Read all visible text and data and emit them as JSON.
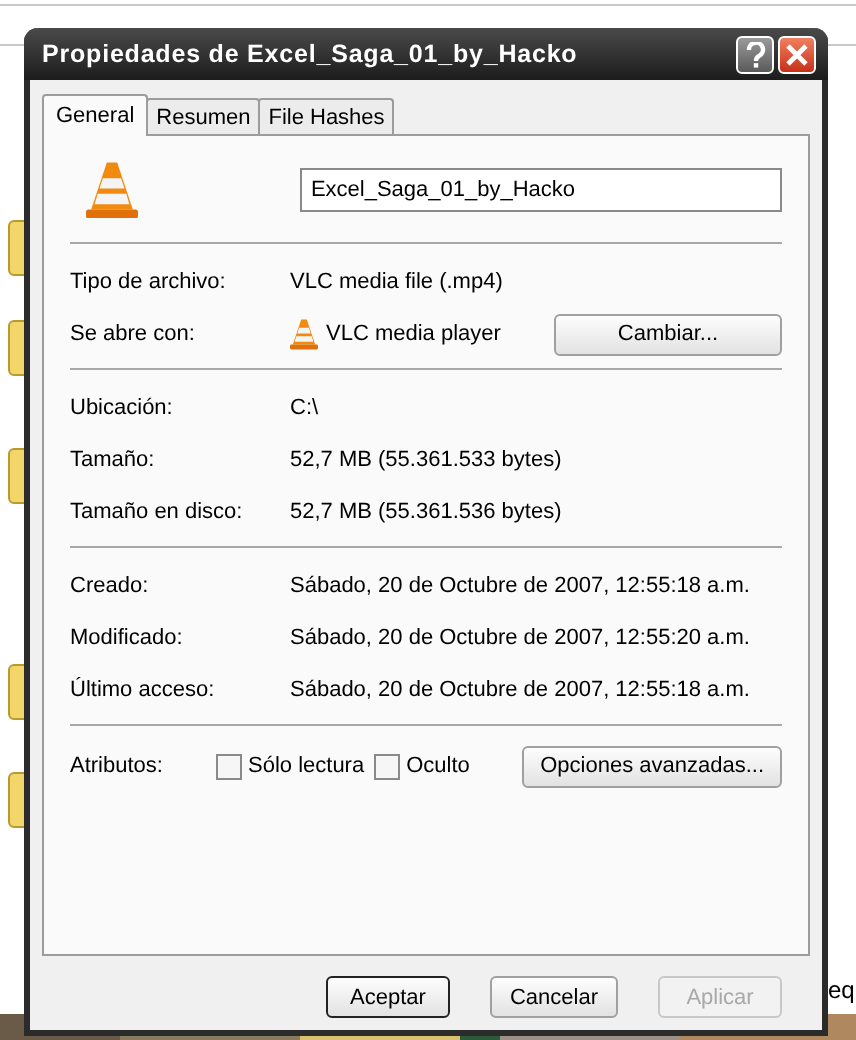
{
  "window": {
    "title": "Propiedades de Excel_Saga_01_by_Hacko"
  },
  "tabs": [
    {
      "label": "General",
      "selected": true
    },
    {
      "label": "Resumen",
      "selected": false
    },
    {
      "label": "File Hashes",
      "selected": false
    }
  ],
  "file_name": {
    "value": "Excel_Saga_01_by_Hacko"
  },
  "sections": [
    {
      "rows": [
        {
          "kind": "text",
          "label": "Tipo de archivo:",
          "value": "VLC media file (.mp4)"
        },
        {
          "kind": "app",
          "label": "Se abre con:",
          "value": "VLC media player",
          "button": "Cambiar..."
        }
      ]
    },
    {
      "rows": [
        {
          "kind": "text",
          "label": "Ubicación:",
          "value": "C:\\"
        },
        {
          "kind": "text",
          "label": "Tamaño:",
          "value": "52,7 MB (55.361.533 bytes)"
        },
        {
          "kind": "text",
          "label": "Tamaño en disco:",
          "value": "52,7 MB (55.361.536 bytes)"
        }
      ]
    },
    {
      "rows": [
        {
          "kind": "text",
          "label": "Creado:",
          "value": "Sábado, 20 de Octubre de 2007, 12:55:18 a.m."
        },
        {
          "kind": "text",
          "label": "Modificado:",
          "value": "Sábado, 20 de Octubre de 2007, 12:55:20 a.m."
        },
        {
          "kind": "text",
          "label": "Último acceso:",
          "value": "Sábado, 20 de Octubre de 2007, 12:55:18 a.m."
        }
      ]
    }
  ],
  "attributes": {
    "label": "Atributos:",
    "checkboxes": [
      {
        "label": "Sólo lectura",
        "checked": false
      },
      {
        "label": "Oculto",
        "checked": false
      }
    ],
    "button": "Opciones avanzadas..."
  },
  "buttons": [
    {
      "label": "Aceptar",
      "disabled": false,
      "default": true
    },
    {
      "label": "Cancelar",
      "disabled": false,
      "default": false
    },
    {
      "label": "Aplicar",
      "disabled": true,
      "default": false
    }
  ],
  "background_text": "eq"
}
